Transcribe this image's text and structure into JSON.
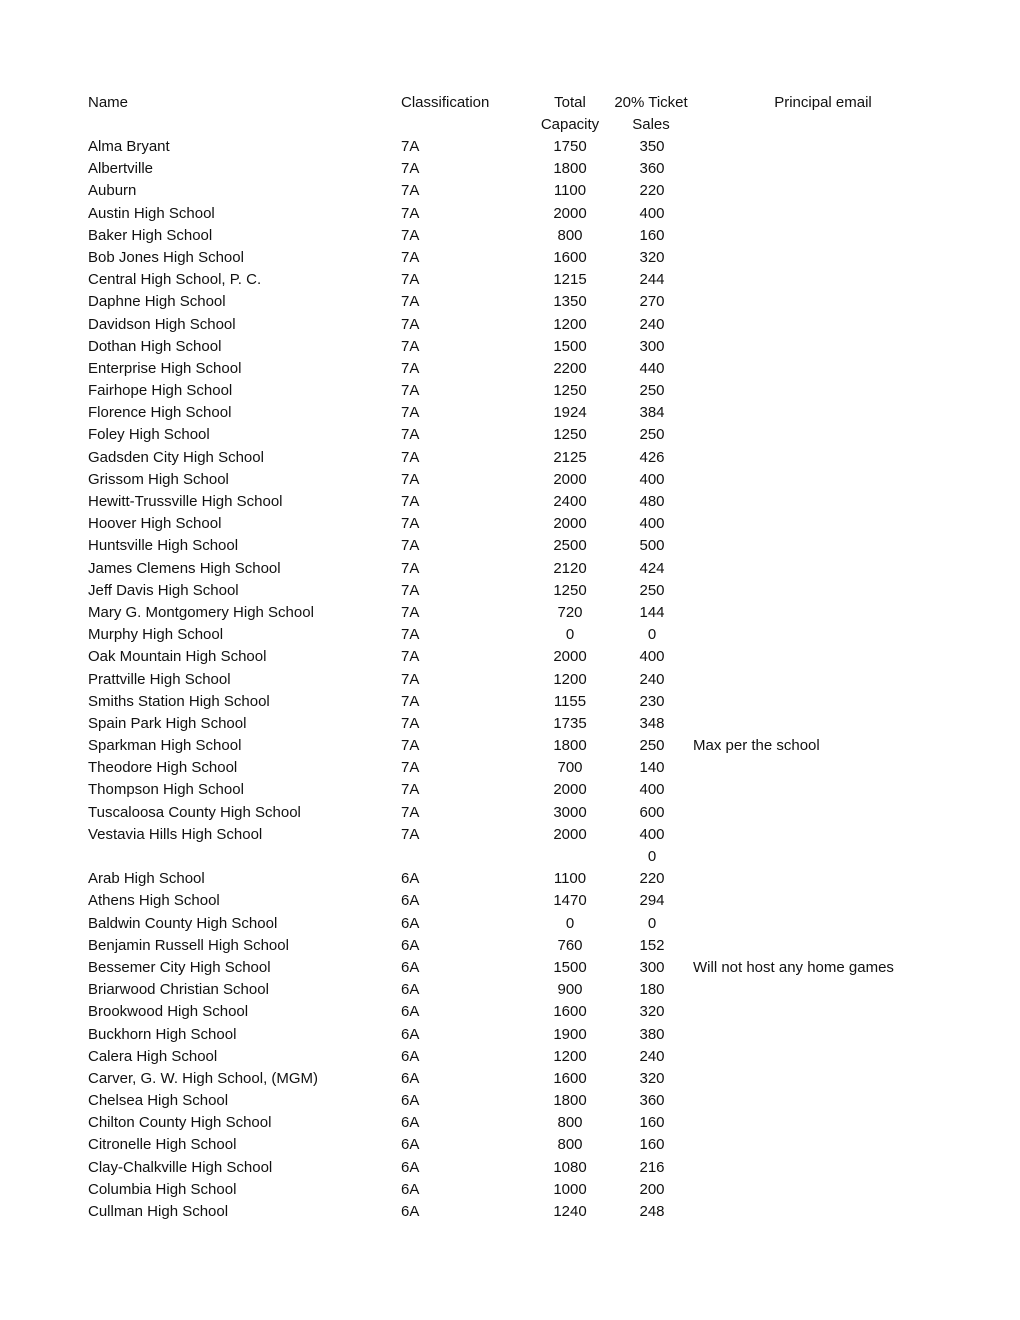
{
  "headers": {
    "name": "Name",
    "classification": "Classification",
    "capacity": "Total Capacity",
    "sales": "20% Ticket Sales",
    "email": "Principal email"
  },
  "rows": [
    {
      "name": "Alma Bryant",
      "class": "7A",
      "capacity": "1750",
      "sales": "350",
      "note": ""
    },
    {
      "name": "Albertville",
      "class": "7A",
      "capacity": "1800",
      "sales": "360",
      "note": ""
    },
    {
      "name": "Auburn",
      "class": "7A",
      "capacity": "1100",
      "sales": "220",
      "note": ""
    },
    {
      "name": "Austin High School",
      "class": "7A",
      "capacity": "2000",
      "sales": "400",
      "note": ""
    },
    {
      "name": "Baker High School",
      "class": "7A",
      "capacity": "800",
      "sales": "160",
      "note": ""
    },
    {
      "name": "Bob Jones High School",
      "class": "7A",
      "capacity": "1600",
      "sales": "320",
      "note": ""
    },
    {
      "name": "Central High School, P. C.",
      "class": "7A",
      "capacity": "1215",
      "sales": "244",
      "note": ""
    },
    {
      "name": "Daphne High School",
      "class": "7A",
      "capacity": "1350",
      "sales": "270",
      "note": ""
    },
    {
      "name": "Davidson High School",
      "class": "7A",
      "capacity": "1200",
      "sales": "240",
      "note": ""
    },
    {
      "name": "Dothan High School",
      "class": "7A",
      "capacity": "1500",
      "sales": "300",
      "note": ""
    },
    {
      "name": "Enterprise High School",
      "class": "7A",
      "capacity": "2200",
      "sales": "440",
      "note": ""
    },
    {
      "name": "Fairhope High School",
      "class": "7A",
      "capacity": "1250",
      "sales": "250",
      "note": ""
    },
    {
      "name": "Florence High School",
      "class": "7A",
      "capacity": "1924",
      "sales": "384",
      "note": ""
    },
    {
      "name": "Foley High School",
      "class": "7A",
      "capacity": "1250",
      "sales": "250",
      "note": ""
    },
    {
      "name": "Gadsden City High School",
      "class": "7A",
      "capacity": "2125",
      "sales": "426",
      "note": ""
    },
    {
      "name": "Grissom High School",
      "class": "7A",
      "capacity": "2000",
      "sales": "400",
      "note": ""
    },
    {
      "name": "Hewitt-Trussville High School",
      "class": "7A",
      "capacity": "2400",
      "sales": "480",
      "note": ""
    },
    {
      "name": "Hoover High School",
      "class": "7A",
      "capacity": "2000",
      "sales": "400",
      "note": ""
    },
    {
      "name": "Huntsville High School",
      "class": "7A",
      "capacity": "2500",
      "sales": "500",
      "note": ""
    },
    {
      "name": "James Clemens High School",
      "class": "7A",
      "capacity": "2120",
      "sales": "424",
      "note": ""
    },
    {
      "name": "Jeff Davis High School",
      "class": "7A",
      "capacity": "1250",
      "sales": "250",
      "note": ""
    },
    {
      "name": "Mary G. Montgomery High School",
      "class": "7A",
      "capacity": "720",
      "sales": "144",
      "note": ""
    },
    {
      "name": "Murphy High School",
      "class": "7A",
      "capacity": "0",
      "sales": "0",
      "note": ""
    },
    {
      "name": "Oak Mountain High School",
      "class": "7A",
      "capacity": "2000",
      "sales": "400",
      "note": ""
    },
    {
      "name": "Prattville High School",
      "class": "7A",
      "capacity": "1200",
      "sales": "240",
      "note": ""
    },
    {
      "name": "Smiths Station High School",
      "class": "7A",
      "capacity": "1155",
      "sales": "230",
      "note": ""
    },
    {
      "name": "Spain Park High School",
      "class": "7A",
      "capacity": "1735",
      "sales": "348",
      "note": ""
    },
    {
      "name": "Sparkman High School",
      "class": "7A",
      "capacity": "1800",
      "sales": "250",
      "note": "Max per the school"
    },
    {
      "name": "Theodore High School",
      "class": "7A",
      "capacity": "700",
      "sales": "140",
      "note": ""
    },
    {
      "name": "Thompson High School",
      "class": "7A",
      "capacity": "2000",
      "sales": "400",
      "note": ""
    },
    {
      "name": "Tuscaloosa County High School",
      "class": "7A",
      "capacity": "3000",
      "sales": "600",
      "note": ""
    },
    {
      "name": "Vestavia Hills High School",
      "class": "7A",
      "capacity": "2000",
      "sales": "400",
      "note": ""
    },
    {
      "name": "",
      "class": "",
      "capacity": "",
      "sales": "0",
      "note": ""
    },
    {
      "name": "Arab High School",
      "class": "6A",
      "capacity": "1100",
      "sales": "220",
      "note": ""
    },
    {
      "name": "Athens High School",
      "class": "6A",
      "capacity": "1470",
      "sales": "294",
      "note": ""
    },
    {
      "name": "Baldwin County High School",
      "class": "6A",
      "capacity": "0",
      "sales": "0",
      "note": ""
    },
    {
      "name": "Benjamin Russell High School",
      "class": "6A",
      "capacity": "760",
      "sales": "152",
      "note": ""
    },
    {
      "name": "Bessemer City High School",
      "class": "6A",
      "capacity": "1500",
      "sales": "300",
      "note": "Will not host any home games"
    },
    {
      "name": "Briarwood Christian School",
      "class": "6A",
      "capacity": "900",
      "sales": "180",
      "note": ""
    },
    {
      "name": "Brookwood High School",
      "class": "6A",
      "capacity": "1600",
      "sales": "320",
      "note": ""
    },
    {
      "name": "Buckhorn High School",
      "class": "6A",
      "capacity": "1900",
      "sales": "380",
      "note": ""
    },
    {
      "name": "Calera High School",
      "class": "6A",
      "capacity": "1200",
      "sales": "240",
      "note": ""
    },
    {
      "name": "Carver, G. W. High School, (MGM)",
      "class": "6A",
      "capacity": "1600",
      "sales": "320",
      "note": ""
    },
    {
      "name": "Chelsea High School",
      "class": "6A",
      "capacity": "1800",
      "sales": "360",
      "note": ""
    },
    {
      "name": "Chilton County High School",
      "class": "6A",
      "capacity": "800",
      "sales": "160",
      "note": ""
    },
    {
      "name": "Citronelle High School",
      "class": "6A",
      "capacity": "800",
      "sales": "160",
      "note": ""
    },
    {
      "name": "Clay-Chalkville High School",
      "class": "6A",
      "capacity": "1080",
      "sales": "216",
      "note": ""
    },
    {
      "name": "Columbia High School",
      "class": "6A",
      "capacity": "1000",
      "sales": "200",
      "note": ""
    },
    {
      "name": "Cullman High School",
      "class": "6A",
      "capacity": "1240",
      "sales": "248",
      "note": ""
    }
  ]
}
